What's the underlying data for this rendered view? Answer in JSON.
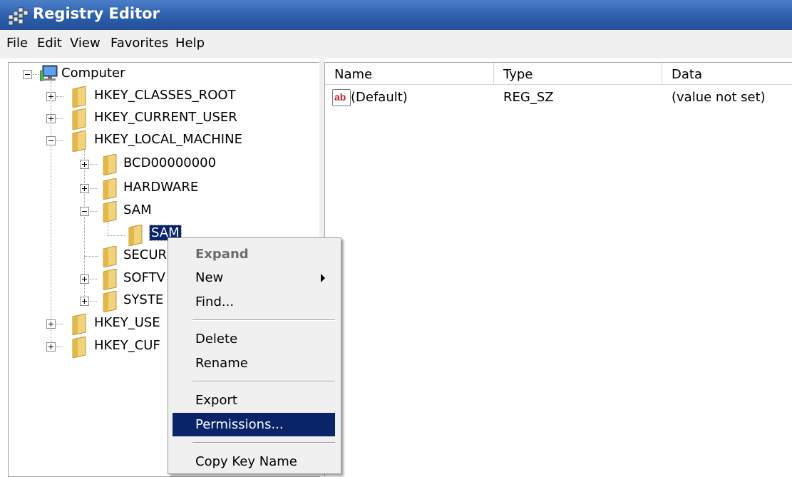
{
  "window": {
    "title": "Registry Editor",
    "icon": "registry-editor-icon"
  },
  "menubar": {
    "items": [
      "File",
      "Edit",
      "View",
      "Favorites",
      "Help"
    ]
  },
  "tree": {
    "root": "Computer",
    "nodes": [
      "HKEY_CLASSES_ROOT",
      "HKEY_CURRENT_USER",
      "HKEY_LOCAL_MACHINE",
      "BCD00000000",
      "HARDWARE",
      "SAM",
      "SAM",
      "SECUR",
      "SOFTV",
      "SYSTE",
      "HKEY_USE",
      "HKEY_CUF"
    ],
    "selected": "SAM"
  },
  "list": {
    "columns": [
      "Name",
      "Type",
      "Data"
    ],
    "rows": [
      {
        "name": "(Default)",
        "type": "REG_SZ",
        "data": "(value not set)",
        "icon": "string-value-icon",
        "icon_text": "ab"
      }
    ]
  },
  "context_menu": {
    "items": [
      "Expand",
      "New",
      "Find...",
      "Delete",
      "Rename",
      "Export",
      "Permissions...",
      "Copy Key Name"
    ],
    "disabled": "Expand",
    "highlighted": "Permissions..."
  },
  "colors": {
    "titlebar": "#2d5fab",
    "selection": "#0a246a",
    "menu_bg": "#f0f0f0"
  }
}
